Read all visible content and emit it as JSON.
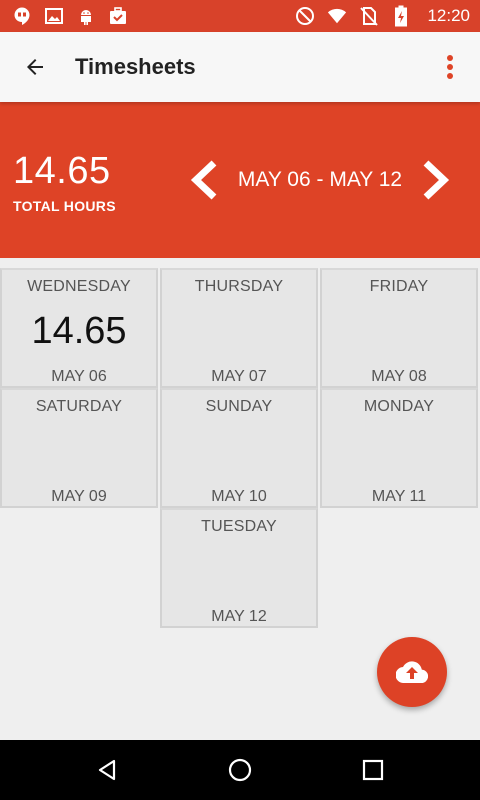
{
  "status_bar": {
    "time": "12:20",
    "left_icons": [
      "hangouts-icon",
      "image-icon",
      "android-icon",
      "briefcase-icon"
    ],
    "right_icons": [
      "do-not-disturb-icon",
      "wifi-icon",
      "no-sim-icon",
      "battery-charging-icon"
    ]
  },
  "app_bar": {
    "title": "Timesheets",
    "back_icon": "arrow-back-icon",
    "menu_icon": "more-vert-icon"
  },
  "summary": {
    "total_value": "14.65",
    "total_label": "TOTAL HOURS",
    "range": "MAY 06 - MAY 12"
  },
  "days": [
    {
      "name": "WEDNESDAY",
      "hours": "14.65",
      "date": "MAY 06"
    },
    {
      "name": "THURSDAY",
      "hours": "",
      "date": "MAY 07"
    },
    {
      "name": "FRIDAY",
      "hours": "",
      "date": "MAY 08"
    },
    {
      "name": "SATURDAY",
      "hours": "",
      "date": "MAY 09"
    },
    {
      "name": "SUNDAY",
      "hours": "",
      "date": "MAY 10"
    },
    {
      "name": "MONDAY",
      "hours": "",
      "date": "MAY 11"
    },
    {
      "name": "TUESDAY",
      "hours": "",
      "date": "MAY 12"
    }
  ],
  "fab_icon": "cloud-upload-icon",
  "colors": {
    "accent": "#de4326",
    "status_bar": "#d8422a",
    "app_bar": "#f7f7f7",
    "tile": "#e6e6e6",
    "background": "#efefef"
  }
}
